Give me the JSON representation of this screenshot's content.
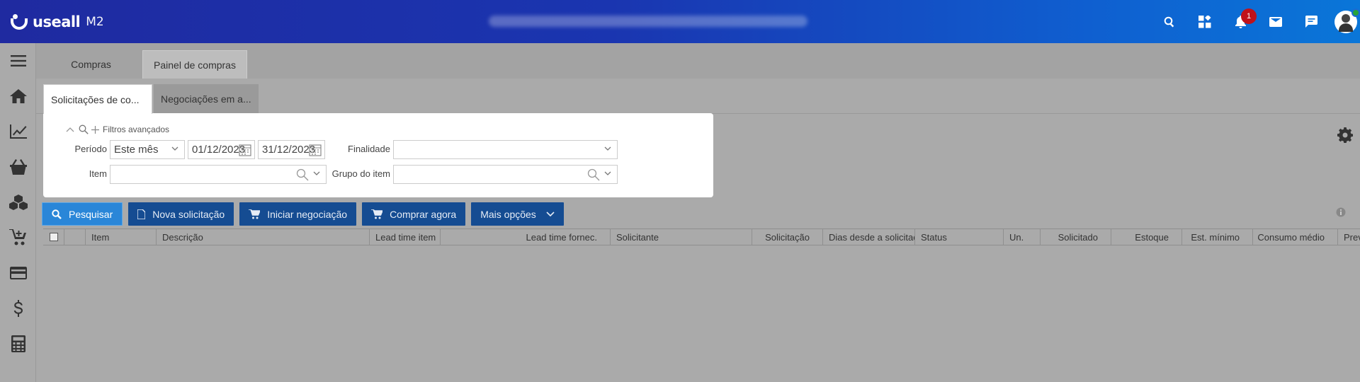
{
  "header": {
    "brand": "useall",
    "brand_sub": "M2",
    "notification_count": "1"
  },
  "sidebar": {
    "items": [
      "menu-icon",
      "home-icon",
      "chart-line-icon",
      "basket-icon",
      "boxes-icon",
      "cart-add-icon",
      "credit-card-icon",
      "dollar-icon",
      "calculator-icon"
    ]
  },
  "tabs": [
    {
      "label": "Compras",
      "active": false
    },
    {
      "label": "Painel de compras",
      "active": true
    }
  ],
  "subtabs": [
    {
      "label": "Solicitações de co...",
      "active": true
    },
    {
      "label": "Negociações em a...",
      "active": false
    }
  ],
  "filters": {
    "advanced_label": "Filtros avançados",
    "periodo_label": "Período",
    "periodo_value": "Este mês",
    "date_from": "01/12/2023",
    "date_to": "31/12/2023",
    "finalidade_label": "Finalidade",
    "finalidade_value": "",
    "item_label": "Item",
    "item_value": "",
    "grupo_label": "Grupo do item",
    "grupo_value": ""
  },
  "actions": {
    "pesquisar": "Pesquisar",
    "nova": "Nova solicitação",
    "iniciar": "Iniciar negociação",
    "comprar": "Comprar agora",
    "mais": "Mais opções"
  },
  "table": {
    "columns": [
      "Item",
      "Descrição",
      "Lead time item",
      "Lead time fornec.",
      "Solicitante",
      "Solicitação",
      "Dias desde a solicitação",
      "Status",
      "Un.",
      "Solicitado",
      "Estoque",
      "Est. mínimo",
      "Consumo médio",
      "Prev"
    ],
    "rows": []
  },
  "colors": {
    "header_start": "#1f2aa0",
    "header_end": "#0a76d8",
    "button": "#154c92",
    "button_primary": "#2a86d8",
    "badge": "#c0111a"
  }
}
